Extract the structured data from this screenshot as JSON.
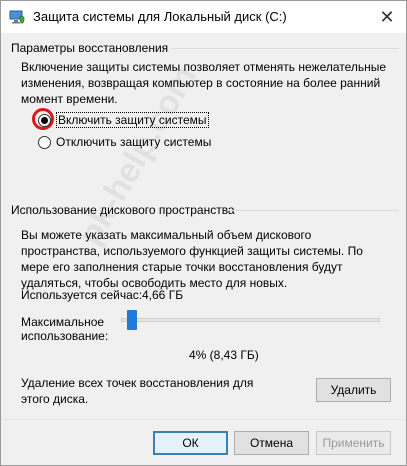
{
  "window": {
    "title": "Защита системы для Локальный диск (С:)",
    "close_glyph": "✕"
  },
  "restore": {
    "group_title": "Параметры восстановления",
    "description": "Включение защиты системы позволяет отменять нежелательные изменения, возвращая компьютер в состояние на более ранний момент времени.",
    "options": [
      {
        "label": "Включить защиту системы",
        "checked": true
      },
      {
        "label": "Отключить защиту системы",
        "checked": false
      }
    ]
  },
  "disk": {
    "group_title": "Использование дискового пространства",
    "description": "Вы можете указать максимальный объем дискового пространства, используемого функцией защиты системы. По мере его заполнения старые точки восстановления будут удаляться, чтобы освободить место для новых.",
    "current_label": "Используется сейчас:",
    "current_value": "4,66 ГБ",
    "max_label_line1": "Максимальное",
    "max_label_line2": "использование:",
    "slider_level_percent": 4,
    "slider_value_text": "4% (8,43 ГБ)",
    "delete_text": "Удаление всех точек восстановления для этого диска.",
    "delete_button": "Удалить"
  },
  "footer": {
    "ok": "ОК",
    "cancel": "Отмена",
    "apply": "Применить"
  },
  "watermark": "pk-help.com",
  "colors": {
    "highlight_ring": "#e0161e",
    "slider_thumb": "#1e7ad6",
    "default_button_border": "#3c7fb1"
  }
}
